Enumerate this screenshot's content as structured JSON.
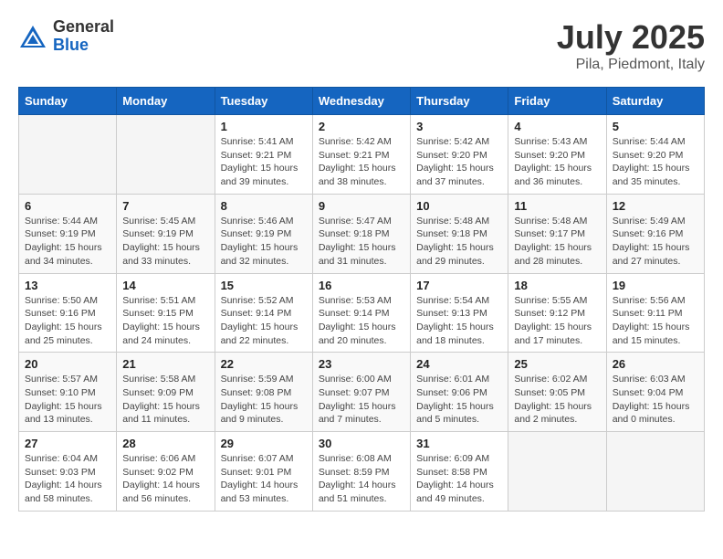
{
  "header": {
    "logo_general": "General",
    "logo_blue": "Blue",
    "title": "July 2025",
    "subtitle": "Pila, Piedmont, Italy"
  },
  "calendar": {
    "columns": [
      "Sunday",
      "Monday",
      "Tuesday",
      "Wednesday",
      "Thursday",
      "Friday",
      "Saturday"
    ],
    "weeks": [
      [
        {
          "day": "",
          "info": ""
        },
        {
          "day": "",
          "info": ""
        },
        {
          "day": "1",
          "info": "Sunrise: 5:41 AM\nSunset: 9:21 PM\nDaylight: 15 hours and 39 minutes."
        },
        {
          "day": "2",
          "info": "Sunrise: 5:42 AM\nSunset: 9:21 PM\nDaylight: 15 hours and 38 minutes."
        },
        {
          "day": "3",
          "info": "Sunrise: 5:42 AM\nSunset: 9:20 PM\nDaylight: 15 hours and 37 minutes."
        },
        {
          "day": "4",
          "info": "Sunrise: 5:43 AM\nSunset: 9:20 PM\nDaylight: 15 hours and 36 minutes."
        },
        {
          "day": "5",
          "info": "Sunrise: 5:44 AM\nSunset: 9:20 PM\nDaylight: 15 hours and 35 minutes."
        }
      ],
      [
        {
          "day": "6",
          "info": "Sunrise: 5:44 AM\nSunset: 9:19 PM\nDaylight: 15 hours and 34 minutes."
        },
        {
          "day": "7",
          "info": "Sunrise: 5:45 AM\nSunset: 9:19 PM\nDaylight: 15 hours and 33 minutes."
        },
        {
          "day": "8",
          "info": "Sunrise: 5:46 AM\nSunset: 9:19 PM\nDaylight: 15 hours and 32 minutes."
        },
        {
          "day": "9",
          "info": "Sunrise: 5:47 AM\nSunset: 9:18 PM\nDaylight: 15 hours and 31 minutes."
        },
        {
          "day": "10",
          "info": "Sunrise: 5:48 AM\nSunset: 9:18 PM\nDaylight: 15 hours and 29 minutes."
        },
        {
          "day": "11",
          "info": "Sunrise: 5:48 AM\nSunset: 9:17 PM\nDaylight: 15 hours and 28 minutes."
        },
        {
          "day": "12",
          "info": "Sunrise: 5:49 AM\nSunset: 9:16 PM\nDaylight: 15 hours and 27 minutes."
        }
      ],
      [
        {
          "day": "13",
          "info": "Sunrise: 5:50 AM\nSunset: 9:16 PM\nDaylight: 15 hours and 25 minutes."
        },
        {
          "day": "14",
          "info": "Sunrise: 5:51 AM\nSunset: 9:15 PM\nDaylight: 15 hours and 24 minutes."
        },
        {
          "day": "15",
          "info": "Sunrise: 5:52 AM\nSunset: 9:14 PM\nDaylight: 15 hours and 22 minutes."
        },
        {
          "day": "16",
          "info": "Sunrise: 5:53 AM\nSunset: 9:14 PM\nDaylight: 15 hours and 20 minutes."
        },
        {
          "day": "17",
          "info": "Sunrise: 5:54 AM\nSunset: 9:13 PM\nDaylight: 15 hours and 18 minutes."
        },
        {
          "day": "18",
          "info": "Sunrise: 5:55 AM\nSunset: 9:12 PM\nDaylight: 15 hours and 17 minutes."
        },
        {
          "day": "19",
          "info": "Sunrise: 5:56 AM\nSunset: 9:11 PM\nDaylight: 15 hours and 15 minutes."
        }
      ],
      [
        {
          "day": "20",
          "info": "Sunrise: 5:57 AM\nSunset: 9:10 PM\nDaylight: 15 hours and 13 minutes."
        },
        {
          "day": "21",
          "info": "Sunrise: 5:58 AM\nSunset: 9:09 PM\nDaylight: 15 hours and 11 minutes."
        },
        {
          "day": "22",
          "info": "Sunrise: 5:59 AM\nSunset: 9:08 PM\nDaylight: 15 hours and 9 minutes."
        },
        {
          "day": "23",
          "info": "Sunrise: 6:00 AM\nSunset: 9:07 PM\nDaylight: 15 hours and 7 minutes."
        },
        {
          "day": "24",
          "info": "Sunrise: 6:01 AM\nSunset: 9:06 PM\nDaylight: 15 hours and 5 minutes."
        },
        {
          "day": "25",
          "info": "Sunrise: 6:02 AM\nSunset: 9:05 PM\nDaylight: 15 hours and 2 minutes."
        },
        {
          "day": "26",
          "info": "Sunrise: 6:03 AM\nSunset: 9:04 PM\nDaylight: 15 hours and 0 minutes."
        }
      ],
      [
        {
          "day": "27",
          "info": "Sunrise: 6:04 AM\nSunset: 9:03 PM\nDaylight: 14 hours and 58 minutes."
        },
        {
          "day": "28",
          "info": "Sunrise: 6:06 AM\nSunset: 9:02 PM\nDaylight: 14 hours and 56 minutes."
        },
        {
          "day": "29",
          "info": "Sunrise: 6:07 AM\nSunset: 9:01 PM\nDaylight: 14 hours and 53 minutes."
        },
        {
          "day": "30",
          "info": "Sunrise: 6:08 AM\nSunset: 8:59 PM\nDaylight: 14 hours and 51 minutes."
        },
        {
          "day": "31",
          "info": "Sunrise: 6:09 AM\nSunset: 8:58 PM\nDaylight: 14 hours and 49 minutes."
        },
        {
          "day": "",
          "info": ""
        },
        {
          "day": "",
          "info": ""
        }
      ]
    ]
  }
}
